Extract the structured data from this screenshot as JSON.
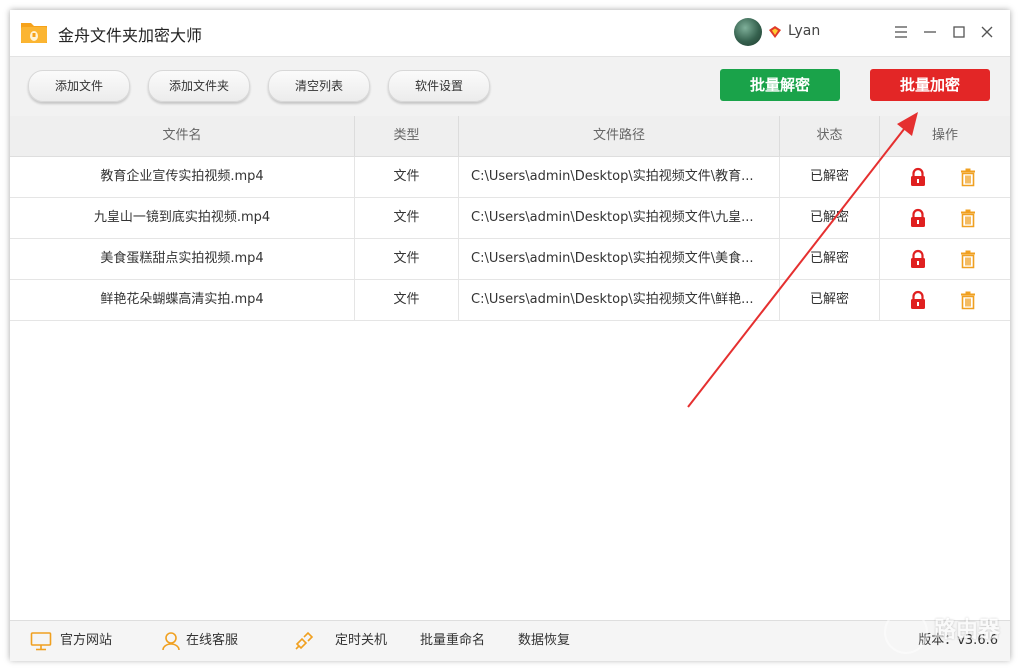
{
  "app": {
    "title": "金舟文件夹加密大师"
  },
  "user": {
    "name": "Lyan"
  },
  "toolbar": {
    "add_file": "添加文件",
    "add_folder": "添加文件夹",
    "clear_list": "清空列表",
    "settings": "软件设置",
    "batch_decrypt": "批量解密",
    "batch_encrypt": "批量加密"
  },
  "table": {
    "headers": [
      "文件名",
      "类型",
      "文件路径",
      "状态",
      "操作"
    ],
    "rows": [
      {
        "name": "教育企业宣传实拍视频.mp4",
        "type": "文件",
        "path": "C:\\Users\\admin\\Desktop\\实拍视频文件\\教育...",
        "status": "已解密"
      },
      {
        "name": "九皇山一镜到底实拍视频.mp4",
        "type": "文件",
        "path": "C:\\Users\\admin\\Desktop\\实拍视频文件\\九皇...",
        "status": "已解密"
      },
      {
        "name": "美食蛋糕甜点实拍视频.mp4",
        "type": "文件",
        "path": "C:\\Users\\admin\\Desktop\\实拍视频文件\\美食...",
        "status": "已解密"
      },
      {
        "name": "鲜艳花朵蝴蝶高清实拍.mp4",
        "type": "文件",
        "path": "C:\\Users\\admin\\Desktop\\实拍视频文件\\鲜艳...",
        "status": "已解密"
      }
    ]
  },
  "statusbar": {
    "official_site": "官方网站",
    "online_service": "在线客服",
    "timed_shutdown": "定时关机",
    "batch_rename": "批量重命名",
    "data_recovery": "数据恢复",
    "version": "版本：v3.6.6"
  },
  "watermark": {
    "text": "路由器"
  },
  "icons": {
    "lock": "lock-icon",
    "trash": "trash-icon",
    "monitor": "monitor-icon",
    "support": "headset-icon",
    "shutdown": "flashlight-icon"
  },
  "colors": {
    "green": "#1aa34a",
    "red": "#e32626",
    "lock": "#e02020",
    "trash": "#f0a020",
    "arrow": "#e53030"
  }
}
